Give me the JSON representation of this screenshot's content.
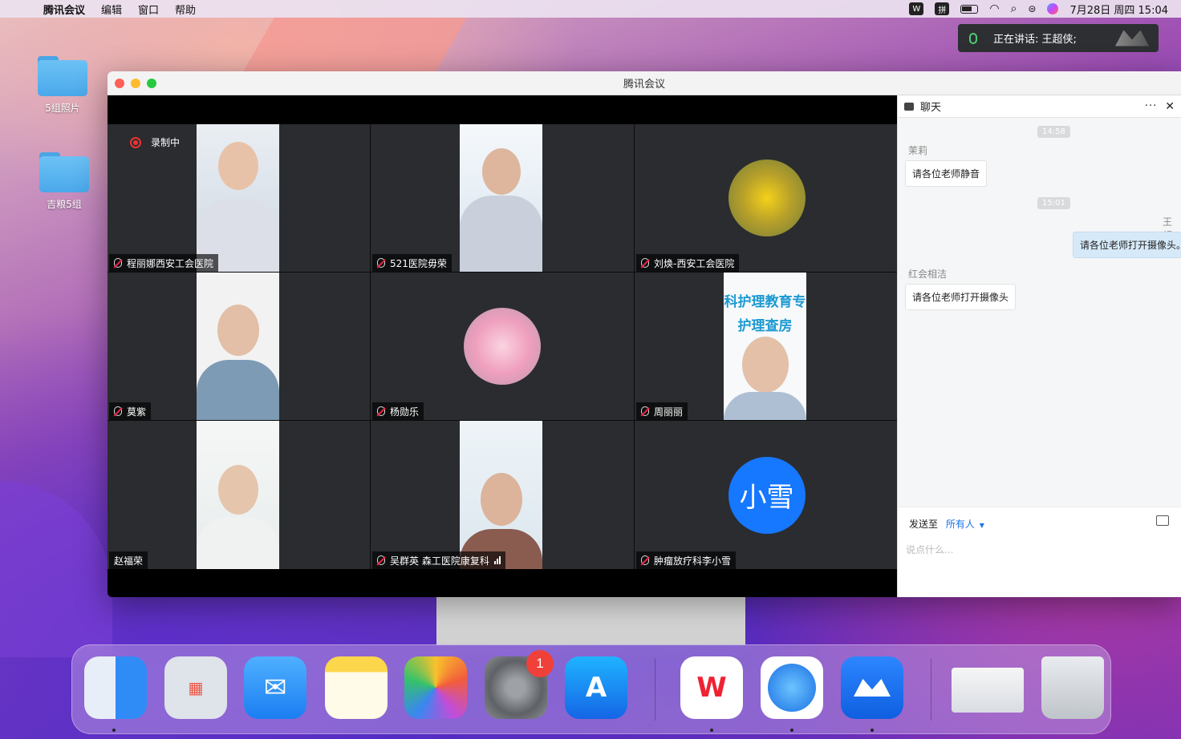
{
  "menubar": {
    "app_name": "腾讯会议",
    "items": [
      "编辑",
      "窗口",
      "帮助"
    ],
    "input_method": "拼",
    "datetime": "7月28日 周四 15:04"
  },
  "desktop": {
    "icons": [
      {
        "label": "5组照片"
      },
      {
        "label": "吉粮5组"
      }
    ]
  },
  "toast": {
    "text": "正在讲话: 王超侠;"
  },
  "window": {
    "title": "腾讯会议",
    "recording_label": "录制中",
    "participants": [
      {
        "name": "程丽娜西安工会医院",
        "muted": true
      },
      {
        "name": "521医院毋荣",
        "muted": true
      },
      {
        "name": "刘焕-西安工会医院",
        "muted": true
      },
      {
        "name": "莫紫",
        "muted": true
      },
      {
        "name": "杨勋乐",
        "muted": true
      },
      {
        "name": "周丽丽",
        "muted": true
      },
      {
        "name": "赵福荣",
        "muted": false
      },
      {
        "name": "吴群英 森工医院康复科",
        "muted": true
      },
      {
        "name": "肿瘤放疗科李小雪",
        "muted": true
      }
    ],
    "avatar_text": "小雪",
    "banner_line1": "科护理教育专",
    "banner_line2": "护理查房"
  },
  "chat": {
    "title": "聊天",
    "messages": [
      {
        "time": "14:58"
      },
      {
        "sender": "茉莉",
        "text": "请各位老师静音"
      },
      {
        "time": "15:01"
      },
      {
        "sender": "王超",
        "text": "请各位老师打开摄像头。",
        "mine": true
      },
      {
        "sender": "红会相洁",
        "text": "请各位老师打开摄像头"
      }
    ],
    "send_to_label": "发送至",
    "send_to_target": "所有人",
    "input_placeholder": "说点什么..."
  },
  "dock": {
    "apps": [
      "finder",
      "launchpad",
      "mail",
      "notes",
      "photos",
      "system-preferences",
      "app-store",
      "wps",
      "safari",
      "tencent-meeting",
      "screenshot-folder",
      "trash"
    ],
    "settings_badge": "1"
  },
  "colors": {
    "accent": "#1b73e8",
    "avatar_blue": "#1677ff",
    "record_red": "#e33333"
  }
}
